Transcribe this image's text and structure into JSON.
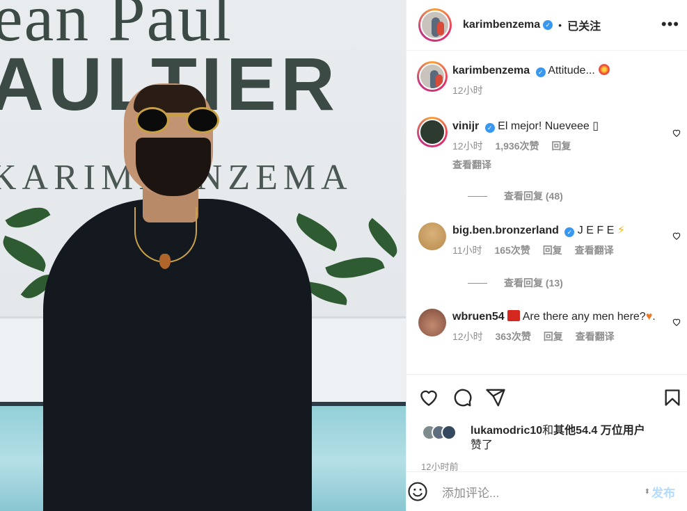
{
  "photo": {
    "wall_line1": "ean Paul",
    "wall_line2": "AULTIER",
    "wall_line3": "KARIMBENZEMA"
  },
  "header": {
    "username": "karimbenzema",
    "separator": "•",
    "follow_status": "已关注",
    "more_icon": "more-horizontal-icon"
  },
  "caption": {
    "username": "karimbenzema",
    "text": "Attitude...",
    "time": "12小时"
  },
  "comments": [
    {
      "username": "vinijr",
      "verified": true,
      "text": "El mejor! Nueveee",
      "trailing": "▯",
      "time": "12小时",
      "likes": "1,936次赞",
      "reply": "回复",
      "translate": "查看翻译",
      "view_replies": "查看回复 (48)"
    },
    {
      "username": "big.ben.bronzerland",
      "verified": true,
      "text": "J E F E",
      "time": "11小时",
      "likes": "165次赞",
      "reply": "回复",
      "translate": "查看翻译",
      "view_replies": "查看回复 (13)"
    },
    {
      "username": "wbruen54",
      "verified": false,
      "text": "Are there any men here?",
      "text_end": ".",
      "time": "12小时",
      "likes": "363次赞",
      "reply": "回复",
      "translate": "查看翻译"
    }
  ],
  "actions": {
    "icons": [
      "heart-icon",
      "comment-icon",
      "share-icon",
      "bookmark-icon"
    ],
    "likes_user": "lukamodric10",
    "likes_mid": "和",
    "likes_count": "其他54.4 万位用户",
    "likes_end": "赞了",
    "time_ago": "12小时前"
  },
  "add_comment": {
    "placeholder": "添加评论...",
    "post_label": "发布",
    "emoji_icon": "smiley-icon"
  },
  "colors": {
    "verified": "#3897f0",
    "post_disabled": "#b3dbff",
    "muted": "#8e8e8e"
  }
}
